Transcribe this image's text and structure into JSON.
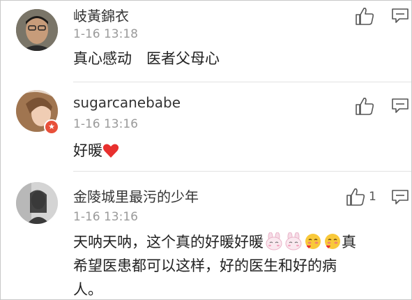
{
  "comments": [
    {
      "user": "岐黃錦衣",
      "time": "1-16 13:18",
      "text": "真心感动　医者父母心",
      "like_count": ""
    },
    {
      "user": "sugarcanebabe",
      "time": "1-16 13:16",
      "text": "好暖",
      "like_count": "",
      "emoji": "red-heart"
    },
    {
      "user": "金陵城里最污的少年",
      "time": "1-16 13:16",
      "text_line1": "天呐天呐，这个真的好暖好暖",
      "text_line1_end": "真",
      "text_line2": "希望医患都可以这样，好的医生和好的病",
      "text_line3": "人。",
      "like_count": "1",
      "emojis": [
        "bunny-face",
        "bunny-face",
        "blushing-face",
        "blushing-face"
      ]
    }
  ],
  "icons": {
    "like": "thumbs-up-icon",
    "reply": "comment-bubble-icon",
    "verified": "star-badge-icon"
  },
  "colors": {
    "heart": "#e8302e",
    "badge": "#e8503a",
    "timestamp": "#9a9a9a"
  }
}
